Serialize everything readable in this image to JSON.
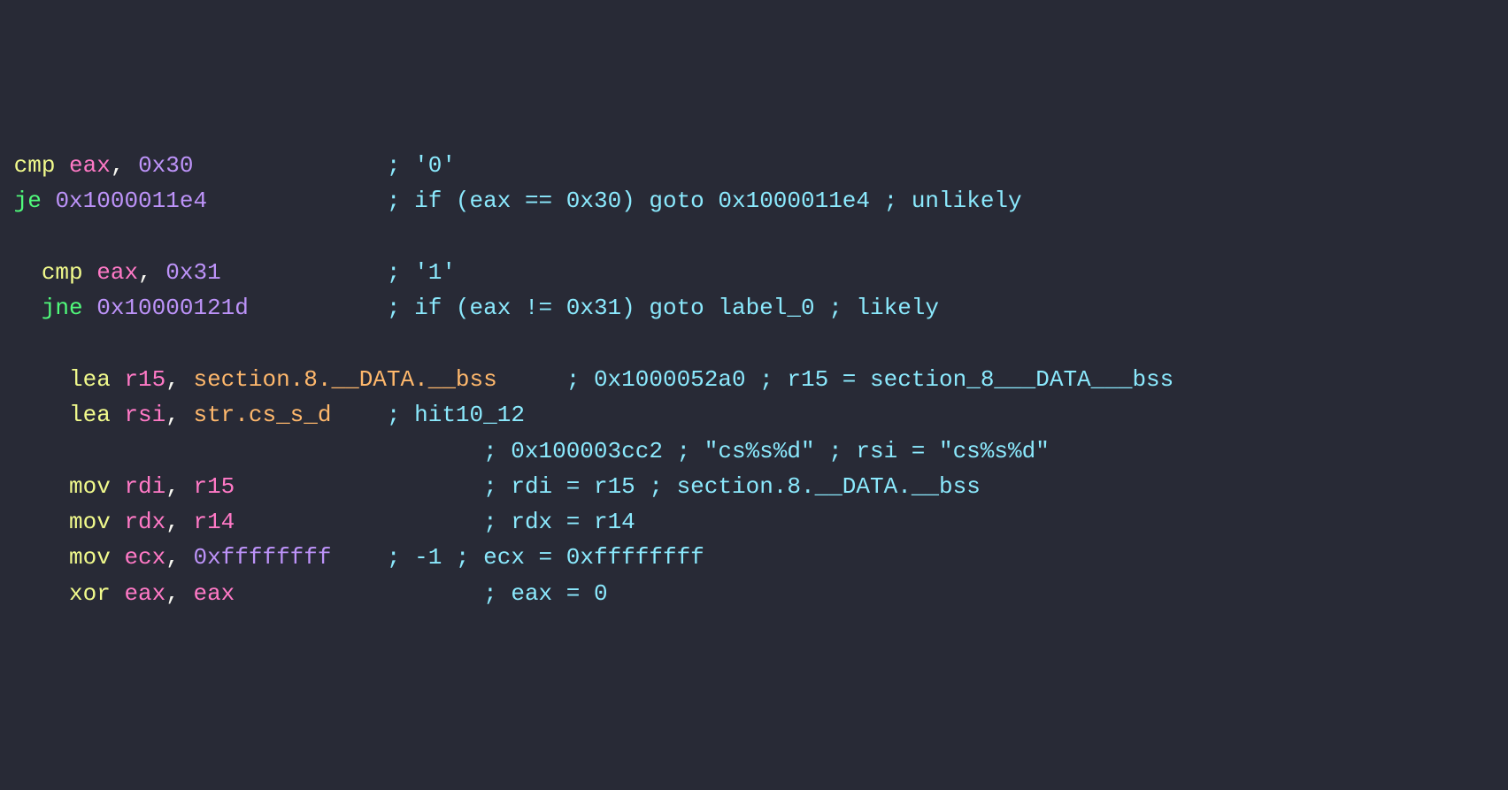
{
  "lines": [
    {
      "indent": " ",
      "tokens": [
        {
          "cls": "mnem",
          "t": "cmp"
        },
        {
          "cls": "punct",
          "t": " "
        },
        {
          "cls": "reg",
          "t": "eax"
        },
        {
          "cls": "punct",
          "t": ", "
        },
        {
          "cls": "num",
          "t": "0x30"
        }
      ],
      "col": 28,
      "comment": "; '0'"
    },
    {
      "indent": " ",
      "tokens": [
        {
          "cls": "mnem-br",
          "t": "je"
        },
        {
          "cls": "punct",
          "t": " "
        },
        {
          "cls": "num",
          "t": "0x1000011e4"
        }
      ],
      "col": 28,
      "comment": "; if (eax == 0x30) goto 0x1000011e4 ; unlikely"
    },
    {
      "blank": true
    },
    {
      "indent": "   ",
      "tokens": [
        {
          "cls": "mnem",
          "t": "cmp"
        },
        {
          "cls": "punct",
          "t": " "
        },
        {
          "cls": "reg",
          "t": "eax"
        },
        {
          "cls": "punct",
          "t": ", "
        },
        {
          "cls": "num",
          "t": "0x31"
        }
      ],
      "col": 28,
      "comment": "; '1'"
    },
    {
      "indent": "   ",
      "tokens": [
        {
          "cls": "mnem-br",
          "t": "jne"
        },
        {
          "cls": "punct",
          "t": " "
        },
        {
          "cls": "num",
          "t": "0x10000121d"
        }
      ],
      "col": 28,
      "comment": "; if (eax != 0x31) goto label_0 ; likely"
    },
    {
      "blank": true
    },
    {
      "indent": "     ",
      "tokens": [
        {
          "cls": "mnem",
          "t": "lea"
        },
        {
          "cls": "punct",
          "t": " "
        },
        {
          "cls": "reg",
          "t": "r15"
        },
        {
          "cls": "punct",
          "t": ", "
        },
        {
          "cls": "sym",
          "t": "section.8.__DATA.__bss"
        }
      ],
      "col": 41,
      "comment": "; 0x1000052a0 ; r15 = section_8___DATA___bss"
    },
    {
      "indent": "     ",
      "tokens": [
        {
          "cls": "mnem",
          "t": "lea"
        },
        {
          "cls": "punct",
          "t": " "
        },
        {
          "cls": "reg",
          "t": "rsi"
        },
        {
          "cls": "punct",
          "t": ", "
        },
        {
          "cls": "sym",
          "t": "str.cs_s_d"
        }
      ],
      "col": 28,
      "comment": "; hit10_12"
    },
    {
      "indent": "",
      "tokens": [],
      "col": 35,
      "comment": "; 0x100003cc2 ; \"cs%s%d\" ; rsi = \"cs%s%d\""
    },
    {
      "indent": "     ",
      "tokens": [
        {
          "cls": "mnem",
          "t": "mov"
        },
        {
          "cls": "punct",
          "t": " "
        },
        {
          "cls": "reg",
          "t": "rdi"
        },
        {
          "cls": "punct",
          "t": ", "
        },
        {
          "cls": "reg",
          "t": "r15"
        }
      ],
      "col": 35,
      "comment": "; rdi = r15 ; section.8.__DATA.__bss"
    },
    {
      "indent": "     ",
      "tokens": [
        {
          "cls": "mnem",
          "t": "mov"
        },
        {
          "cls": "punct",
          "t": " "
        },
        {
          "cls": "reg",
          "t": "rdx"
        },
        {
          "cls": "punct",
          "t": ", "
        },
        {
          "cls": "reg",
          "t": "r14"
        }
      ],
      "col": 35,
      "comment": "; rdx = r14"
    },
    {
      "indent": "     ",
      "tokens": [
        {
          "cls": "mnem",
          "t": "mov"
        },
        {
          "cls": "punct",
          "t": " "
        },
        {
          "cls": "reg",
          "t": "ecx"
        },
        {
          "cls": "punct",
          "t": ", "
        },
        {
          "cls": "num",
          "t": "0xffffffff"
        }
      ],
      "col": 28,
      "comment": "; -1 ; ecx = 0xffffffff"
    },
    {
      "indent": "     ",
      "tokens": [
        {
          "cls": "mnem",
          "t": "xor"
        },
        {
          "cls": "punct",
          "t": " "
        },
        {
          "cls": "reg",
          "t": "eax"
        },
        {
          "cls": "punct",
          "t": ", "
        },
        {
          "cls": "reg",
          "t": "eax"
        }
      ],
      "col": 35,
      "comment": "; eax = 0"
    }
  ]
}
